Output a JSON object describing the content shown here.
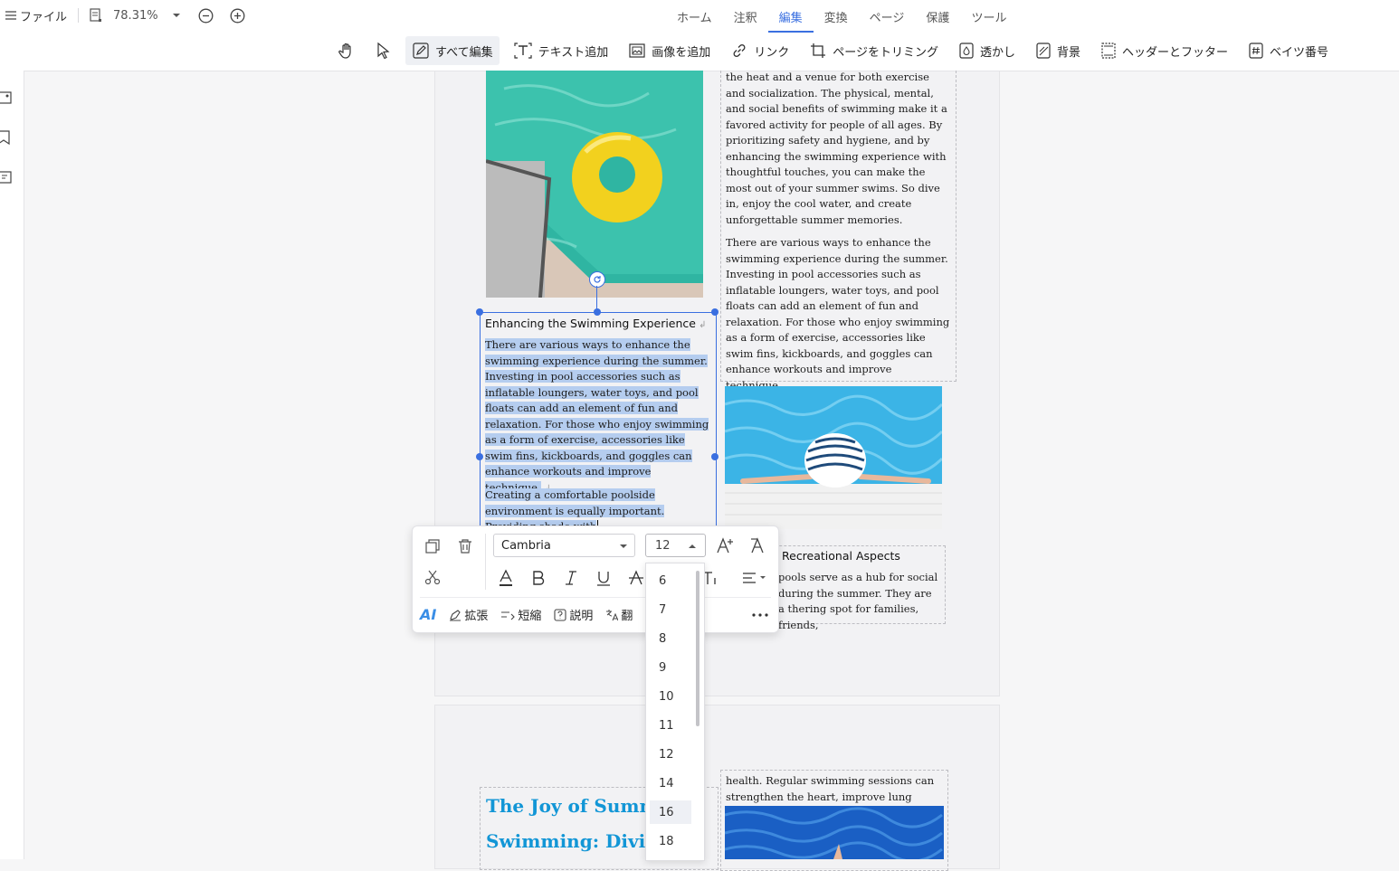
{
  "topbar": {
    "file_label": "ファイル",
    "zoom": "78.31%",
    "tabs": [
      {
        "label": "ホーム"
      },
      {
        "label": "注釈"
      },
      {
        "label": "編集"
      },
      {
        "label": "変換"
      },
      {
        "label": "ページ"
      },
      {
        "label": "保護"
      },
      {
        "label": "ツール"
      }
    ],
    "active_tab": "編集"
  },
  "tools": {
    "edit_all": "すべて編集",
    "add_text": "テキスト追加",
    "add_image": "画像を追加",
    "link": "リンク",
    "crop": "ページをトリミング",
    "watermark": "透かし",
    "background": "背景",
    "header_footer": "ヘッダーとフッター",
    "bates": "ベイツ番号"
  },
  "doc": {
    "right_col_1": "the heat and a venue for both exercise and socialization. The physical, mental, and social benefits of swimming make it a favored activity for people of all ages. By prioritizing safety and hygiene, and by enhancing the swimming experience with thoughtful touches, you can make the most out of your summer swims. So dive in, enjoy the cool water, and create unforgettable summer memories.",
    "right_col_2": "There are various ways to enhance the swimming experience during the summer. Investing in pool accessories such as inflatable loungers, water toys, and pool floats can add an element of fun and relaxation. For those who enjoy swimming as a form of exercise, accessories like swim fins, kickboards, and goggles can enhance workouts and improve technique.",
    "heading": "Enhancing the Swimming Experience",
    "sel_para_1": "There are various ways to enhance the swimming experience during the summer. Investing in pool accessories such as inflatable loungers, water toys, and pool floats can add an element of fun and relaxation. For those who enjoy swimming as a form of exercise, accessories like swim fins, kickboards, and goggles can enhance workouts and improve technique.",
    "sel_para_2": "Creating a comfortable poolside environment is equally important. Providing shade with",
    "recreational_heading": "Recreational Aspects",
    "recreational_text": "pools serve as a hub for social during the summer. They are a thering spot for families, friends,",
    "page2_right": "health. Regular swimming sessions can strengthen the heart, improve lung capacity,",
    "page2_title_1": "The Joy of Summ",
    "page2_title_2": "Swimming: Divin"
  },
  "float_toolbar": {
    "font": "Cambria",
    "size": "12",
    "expand": "拡張",
    "shorten": "短縮",
    "explain": "説明",
    "translate": "翻",
    "ai_label": "AI"
  },
  "font_sizes": [
    "6",
    "7",
    "8",
    "9",
    "10",
    "11",
    "12",
    "14",
    "16",
    "18"
  ],
  "hover_size": "16",
  "colors": {
    "accent": "#3a6fe0",
    "highlight": "#b5cdef",
    "title_blue": "#1296d6"
  }
}
